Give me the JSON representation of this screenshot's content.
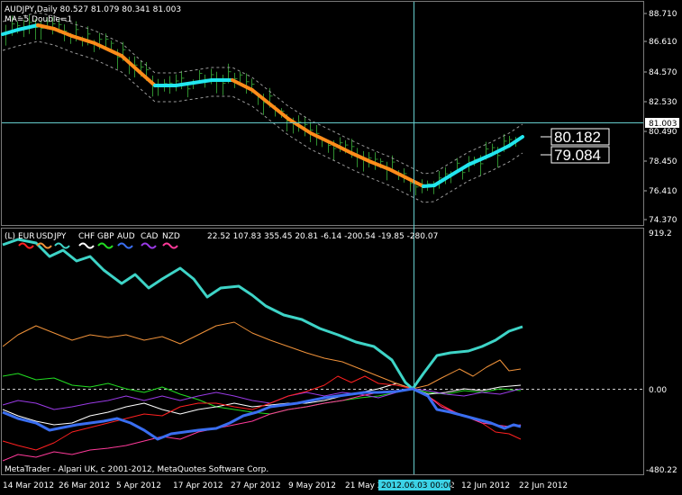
{
  "top_panel": {
    "symbol_line": "AUDJPY,Daily  80.527 81.079 80.341 81.003",
    "indicator_line": "MA=5 Double=1",
    "price_ticks": [
      "88.710",
      "86.610",
      "84.570",
      "82.530",
      "80.490",
      "78.450",
      "76.410",
      "74.370"
    ],
    "current_price": "81.003",
    "band_upper_label": "80.182",
    "band_lower_label": "79.084"
  },
  "bottom_panel": {
    "header_prefix": "(L)",
    "currencies": [
      {
        "name": "EUR",
        "color": "#ff2020"
      },
      {
        "name": "USD",
        "color": "#f0923a"
      },
      {
        "name": "JPY",
        "color": "#3ed4c7"
      },
      {
        "name": "CHF",
        "color": "#ffffff"
      },
      {
        "name": "GBP",
        "color": "#22dd22"
      },
      {
        "name": "AUD",
        "color": "#3a6ef0"
      },
      {
        "name": "CAD",
        "color": "#9a3ae6"
      },
      {
        "name": "NZD",
        "color": "#ff3a9a"
      }
    ],
    "values_text": "22.52 107.83 355.45 20.81 -6.14 -200.54 -19.85 -280.07",
    "scale_top": "919.2",
    "scale_zero": "0.00",
    "scale_bottom": "-480.22",
    "copyright": "MetaTrader - Alpari UK, c 2001-2012, MetaQuotes Software Corp."
  },
  "time_axis": {
    "labels": [
      "14 Mar 2012",
      "26 Mar 2012",
      "5 Apr 2012",
      "17 Apr 2012",
      "27 Apr 2012",
      "9 May 2012",
      "21 May 2012",
      "2",
      "12 Jun 2012",
      "22 Jun 2012"
    ],
    "cursor_label": "2012.06.03 00:00"
  },
  "colors": {
    "ma_orange": "#ff8c1a",
    "ma_cyan": "#22e6ee",
    "bars": "#2f8f2f",
    "crosshair": "#66cccc",
    "cursor_label_bg": "#3cd2e6"
  }
}
